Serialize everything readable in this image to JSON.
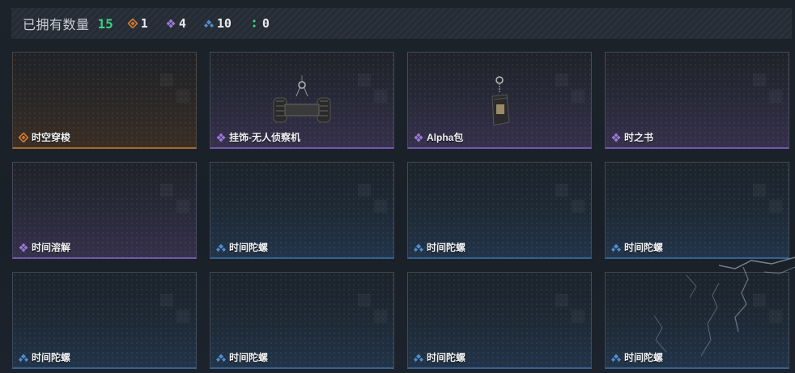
{
  "header": {
    "title": "已拥有数量",
    "total": "15",
    "stats": [
      {
        "rarity": "orange",
        "icon": "orange-rarity-icon",
        "count": "1",
        "color": "#d57a2e"
      },
      {
        "rarity": "purple",
        "icon": "purple-rarity-icon",
        "count": "4",
        "color": "#9a79d6"
      },
      {
        "rarity": "blue",
        "icon": "blue-rarity-icon",
        "count": "10",
        "color": "#4f8fd0"
      },
      {
        "rarity": "green",
        "icon": "green-rarity-icon",
        "count": "0",
        "color": "#3bd07f"
      }
    ]
  },
  "cards": [
    {
      "name": "时空穿梭",
      "rarity": "orange"
    },
    {
      "name": "挂饰-无人侦察机",
      "rarity": "purple",
      "image": "drone-charm"
    },
    {
      "name": "Alpha包",
      "rarity": "purple",
      "image": "bag-charm"
    },
    {
      "name": "时之书",
      "rarity": "purple"
    },
    {
      "name": "时间溶解",
      "rarity": "purple"
    },
    {
      "name": "时间陀螺",
      "rarity": "blue"
    },
    {
      "name": "时间陀螺",
      "rarity": "blue"
    },
    {
      "name": "时间陀螺",
      "rarity": "blue"
    },
    {
      "name": "时间陀螺",
      "rarity": "blue"
    },
    {
      "name": "时间陀螺",
      "rarity": "blue"
    },
    {
      "name": "时间陀螺",
      "rarity": "blue"
    },
    {
      "name": "时间陀螺",
      "rarity": "blue"
    }
  ]
}
